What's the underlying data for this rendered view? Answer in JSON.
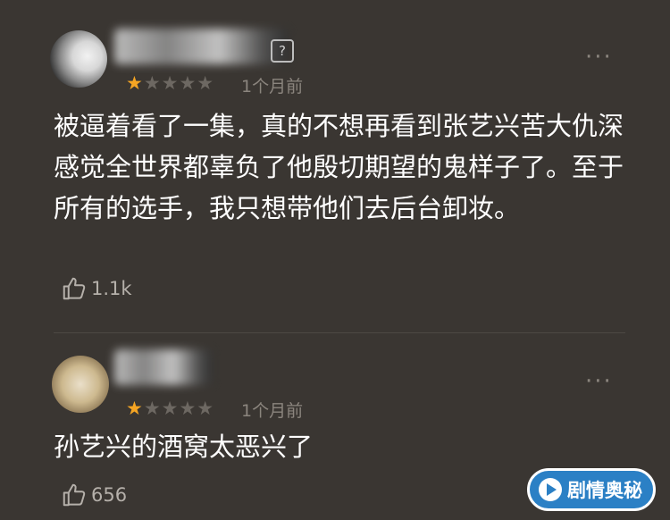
{
  "comments": [
    {
      "mask_glyph": "?",
      "rating_full": "★",
      "rating_empty": "★★★★",
      "time": "1个月前",
      "more_label": "···",
      "text": "被逼着看了一集，真的不想再看到张艺兴苦大仇深感觉全世界都辜负了他殷切期望的鬼样子了。至于所有的选手，我只想带他们去后台卸妆。",
      "likes": "1.1k"
    },
    {
      "rating_full": "★",
      "rating_empty": "★★★★",
      "time": "1个月前",
      "more_label": "···",
      "text": "孙艺兴的酒窝太恶兴了",
      "likes": "656"
    }
  ],
  "watermark": {
    "label": "剧情奥秘"
  },
  "colors": {
    "background": "#3a3632",
    "star_active": "#f5a523",
    "watermark_blue": "#2b80c5"
  }
}
